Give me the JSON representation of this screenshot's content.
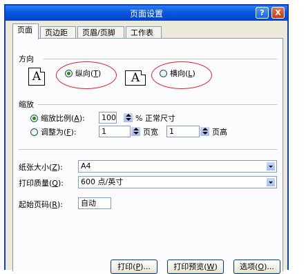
{
  "window": {
    "title": "页面设置",
    "help_glyph": "?",
    "close_glyph": "X"
  },
  "tabs": [
    {
      "label": "页面"
    },
    {
      "label": "页边距"
    },
    {
      "label": "页眉/页脚"
    },
    {
      "label": "工作表"
    }
  ],
  "orientation": {
    "heading": "方向",
    "paper_glyph": "A",
    "portrait": {
      "label": "纵向(",
      "key": "T",
      "suffix": ")",
      "selected": true
    },
    "landscape": {
      "label": "横向(",
      "key": "L",
      "suffix": ")",
      "selected": false
    }
  },
  "scaling": {
    "heading": "缩放",
    "adjust": {
      "label": "缩放比例(",
      "key": "A",
      "suffix": "):",
      "value": "100",
      "unit": "% 正常尺寸",
      "selected": true
    },
    "fit": {
      "label": "调整为(",
      "key": "F",
      "suffix": "):",
      "wide_value": "1",
      "wide_label": "页宽",
      "tall_value": "1",
      "tall_label": "页高",
      "selected": false
    }
  },
  "paper_size": {
    "label": "纸张大小(",
    "key": "Z",
    "suffix": "):",
    "value": "A4"
  },
  "print_quality": {
    "label": "打印质量(",
    "key": "Q",
    "suffix": "):",
    "value": "600 点/英寸"
  },
  "first_page": {
    "label": "起始页码(",
    "key": "R",
    "suffix": "):",
    "value": "自动"
  },
  "buttons": {
    "print": {
      "label": "打印(",
      "key": "P",
      "suffix": ")..."
    },
    "preview": {
      "label": "打印预览(",
      "key": "W",
      "suffix": ")"
    },
    "options": {
      "label": "选项(",
      "key": "O",
      "suffix": ")..."
    }
  },
  "colors": {
    "title_bar": "#0a58e0",
    "annotation": "#d8202a",
    "dialog_bg": "#ece9d8"
  }
}
